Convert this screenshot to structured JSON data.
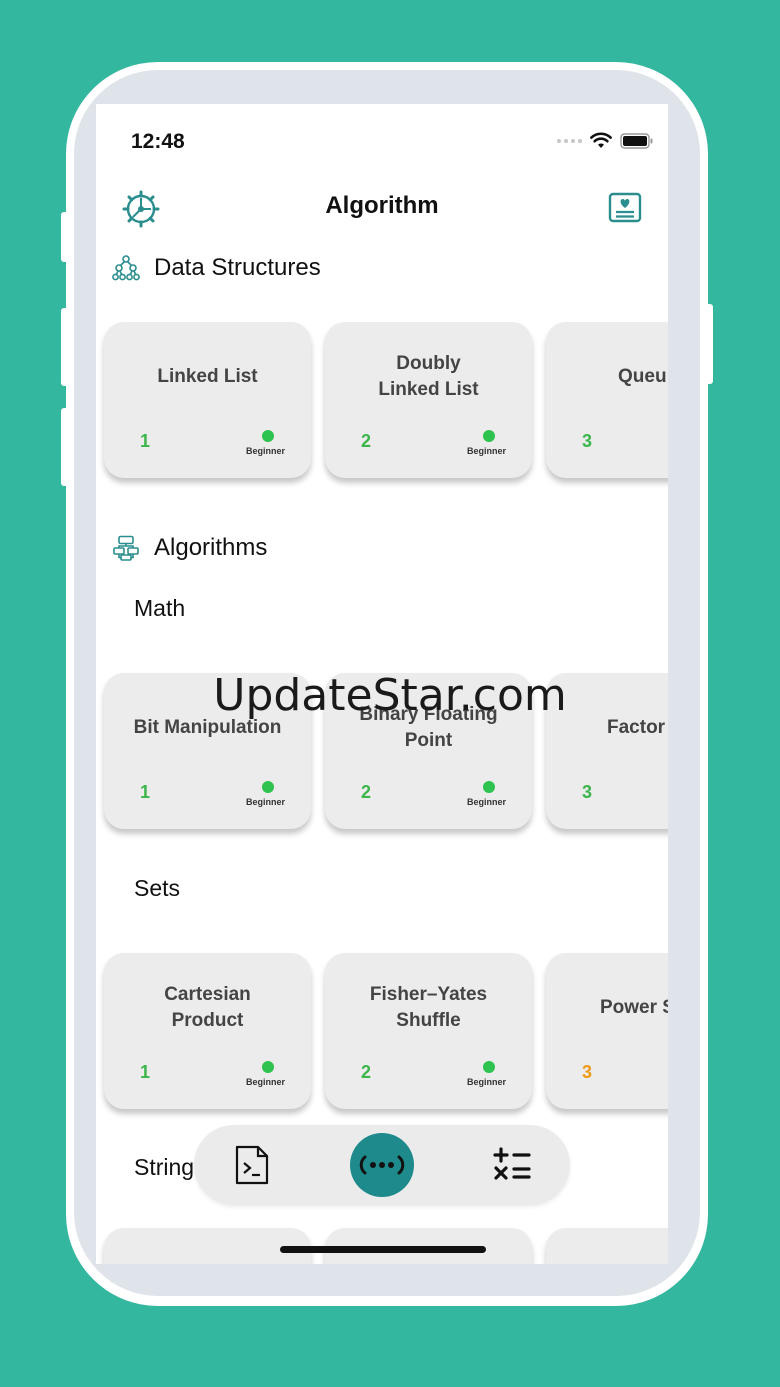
{
  "status": {
    "time": "12:48"
  },
  "header": {
    "title": "Algorithm",
    "settings_icon": "gear-icon",
    "right_icon": "card-heart-icon"
  },
  "sections": {
    "data_structures": {
      "title": "Data Structures",
      "icon": "tree-structure-icon",
      "cards": [
        {
          "title": "Linked List",
          "number": "1",
          "level": "Beginner"
        },
        {
          "title": "Doubly\nLinked List",
          "number": "2",
          "level": "Beginner"
        },
        {
          "title": "Queu",
          "number": "3",
          "level": ""
        }
      ]
    },
    "algorithms": {
      "title": "Algorithms",
      "icon": "flowchart-icon",
      "groups": {
        "math": {
          "title": "Math",
          "cards": [
            {
              "title": "Bit Manipulation",
              "number": "1",
              "level": "Beginner"
            },
            {
              "title": "Binary Floating\nPoint",
              "number": "2",
              "level": "Beginner"
            },
            {
              "title": "Factor",
              "number": "3",
              "level": ""
            }
          ]
        },
        "sets": {
          "title": "Sets",
          "cards": [
            {
              "title": "Cartesian\nProduct",
              "number": "1",
              "level": "Beginner"
            },
            {
              "title": "Fisher–Yates\nShuffle",
              "number": "2",
              "level": "Beginner"
            },
            {
              "title": "Power S",
              "number": "3",
              "level": ""
            }
          ]
        },
        "strings": {
          "title": "String"
        }
      }
    }
  },
  "tabbar": {
    "tabs": [
      {
        "icon": "terminal-file-icon",
        "active": false
      },
      {
        "icon": "dots-code-icon",
        "active": true
      },
      {
        "icon": "math-operators-icon",
        "active": false
      }
    ]
  },
  "colors": {
    "background": "#33b79e",
    "accent": "#1f8a8c",
    "beginner": "#2ec24f",
    "number_green": "#3cb54a",
    "number_orange": "#ef9a18"
  },
  "watermark": "UpdateStar.com"
}
